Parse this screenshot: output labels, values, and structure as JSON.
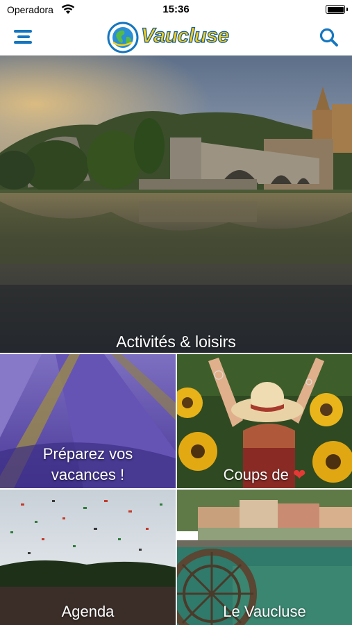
{
  "status_bar": {
    "carrier": "Operadora",
    "time": "15:36"
  },
  "header": {
    "logo_text": "Vaucluse",
    "menu_icon": "hamburger-menu-icon",
    "search_icon": "search-icon"
  },
  "hero": {
    "label": "Activités & loisirs"
  },
  "tiles": [
    {
      "line1": "Préparez vos",
      "line2": "vacances !"
    },
    {
      "label": "Coups de",
      "icon": "heart-icon"
    },
    {
      "label": "Agenda"
    },
    {
      "label": "Le Vaucluse"
    }
  ],
  "colors": {
    "brand_blue": "#1576c0",
    "logo_yellow": "#f4cf1b",
    "heart_red": "#e53935"
  }
}
